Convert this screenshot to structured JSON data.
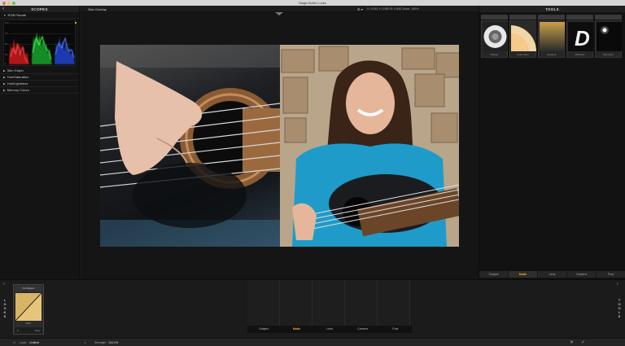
{
  "window": {
    "title": "Magic Bullet Looks"
  },
  "scopes": {
    "title": "SCOPES",
    "items": [
      "RGB Parade",
      "Skin Graph",
      "Hue/Saturation",
      "Hue/Lightness",
      "Memory Colors"
    ],
    "axis": [
      "100",
      "75",
      "50",
      "25",
      "0"
    ]
  },
  "viewer": {
    "split_label": "Skin Overlay",
    "readout": "X: 0.032  Y: 0.900  R: 0.000   Zoom: 100%"
  },
  "tools": {
    "title": "TOOLS",
    "cards": [
      "Diopter",
      "Color Filter",
      "Gradient",
      "Diffusion",
      "Star Filter"
    ],
    "categories": [
      "Subject",
      "Matte",
      "Lens",
      "Camera",
      "Post"
    ],
    "active_category": "Matte"
  },
  "looks": {
    "side_label": "LOOKS",
    "card_title": "No Subject",
    "card_sub": "Mult",
    "card_footer_left": "0",
    "card_footer_right": "Tone"
  },
  "pipeline": {
    "stages": [
      "Subject",
      "Matte",
      "Lens",
      "Camera",
      "Post"
    ],
    "active_stage": "Matte"
  },
  "tools_side_label": "TOOLS",
  "status": {
    "look_label": "Look:",
    "look_value": "Untitled",
    "strength_label": "Strength:",
    "strength_value": "100.0%"
  },
  "colors": {
    "accent": "#f5a623",
    "panel": "#141414",
    "background": "#1a1a1a"
  }
}
